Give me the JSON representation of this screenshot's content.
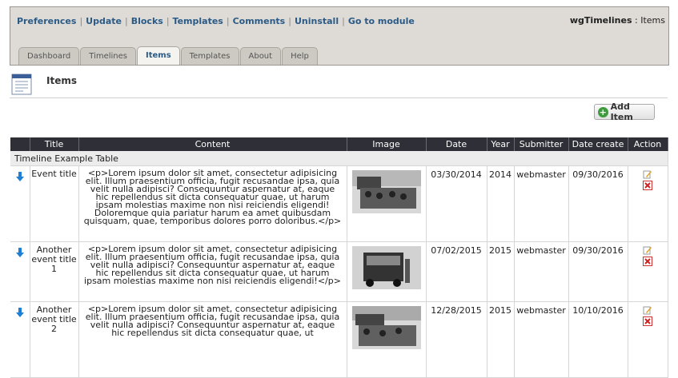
{
  "header": {
    "links": [
      "Preferences",
      "Update",
      "Blocks",
      "Templates",
      "Comments",
      "Uninstall",
      "Go to module"
    ],
    "module_name": "wgTimelines",
    "module_section": ": Items",
    "tabs": [
      {
        "label": "Dashboard",
        "active": false
      },
      {
        "label": "Timelines",
        "active": false
      },
      {
        "label": "Items",
        "active": true
      },
      {
        "label": "Templates",
        "active": false
      },
      {
        "label": "About",
        "active": false
      },
      {
        "label": "Help",
        "active": false
      }
    ]
  },
  "page": {
    "title": "Items",
    "title_icon": "document-icon"
  },
  "toolbar": {
    "add_label": "Add Item"
  },
  "table": {
    "columns": [
      "",
      "Title",
      "Content",
      "Image",
      "Date",
      "Year",
      "Submitter",
      "Date create",
      "Action"
    ],
    "group_label": "Timeline Example Table",
    "rows": [
      {
        "title": "Event title",
        "content": "<p>Lorem ipsum dolor sit amet, consectetur adipisicing elit. Illum praesentium officia, fugit recusandae ipsa, quia velit nulla adipisci? Consequuntur aspernatur at, eaque hic repellendus sit dicta consequatur quae, ut harum ipsam molestias maxime non nisi reiciendis eligendi! Doloremque quia pariatur harum ea amet quibusdam quisquam, quae, temporibus dolores porro doloribus.</p>",
        "date": "03/30/2014",
        "year": "2014",
        "submitter": "webmaster",
        "date_create": "09/30/2016"
      },
      {
        "title": "Another event title 1",
        "content": "<p>Lorem ipsum dolor sit amet, consectetur adipisicing elit. Illum praesentium officia, fugit recusandae ipsa, quia velit nulla adipisci? Consequuntur aspernatur at, eaque hic repellendus sit dicta consequatur quae, ut harum ipsam molestias maxime non nisi reiciendis eligendi!</p>",
        "date": "07/02/2015",
        "year": "2015",
        "submitter": "webmaster",
        "date_create": "09/30/2016"
      },
      {
        "title": "Another event title 2",
        "content": "<p>Lorem ipsum dolor sit amet, consectetur adipisicing elit. Illum praesentium officia, fugit recusandae ipsa, quia velit nulla adipisci? Consequuntur aspernatur at, eaque hic repellendus sit dicta consequatur quae, ut",
        "date": "12/28/2015",
        "year": "2015",
        "submitter": "webmaster",
        "date_create": "10/10/2016"
      }
    ]
  },
  "colors": {
    "link": "#2a5a86",
    "table_header": "#2e2f37",
    "arrow": "#1d7fd6",
    "edit": "#e0a020",
    "delete": "#cc2222"
  }
}
